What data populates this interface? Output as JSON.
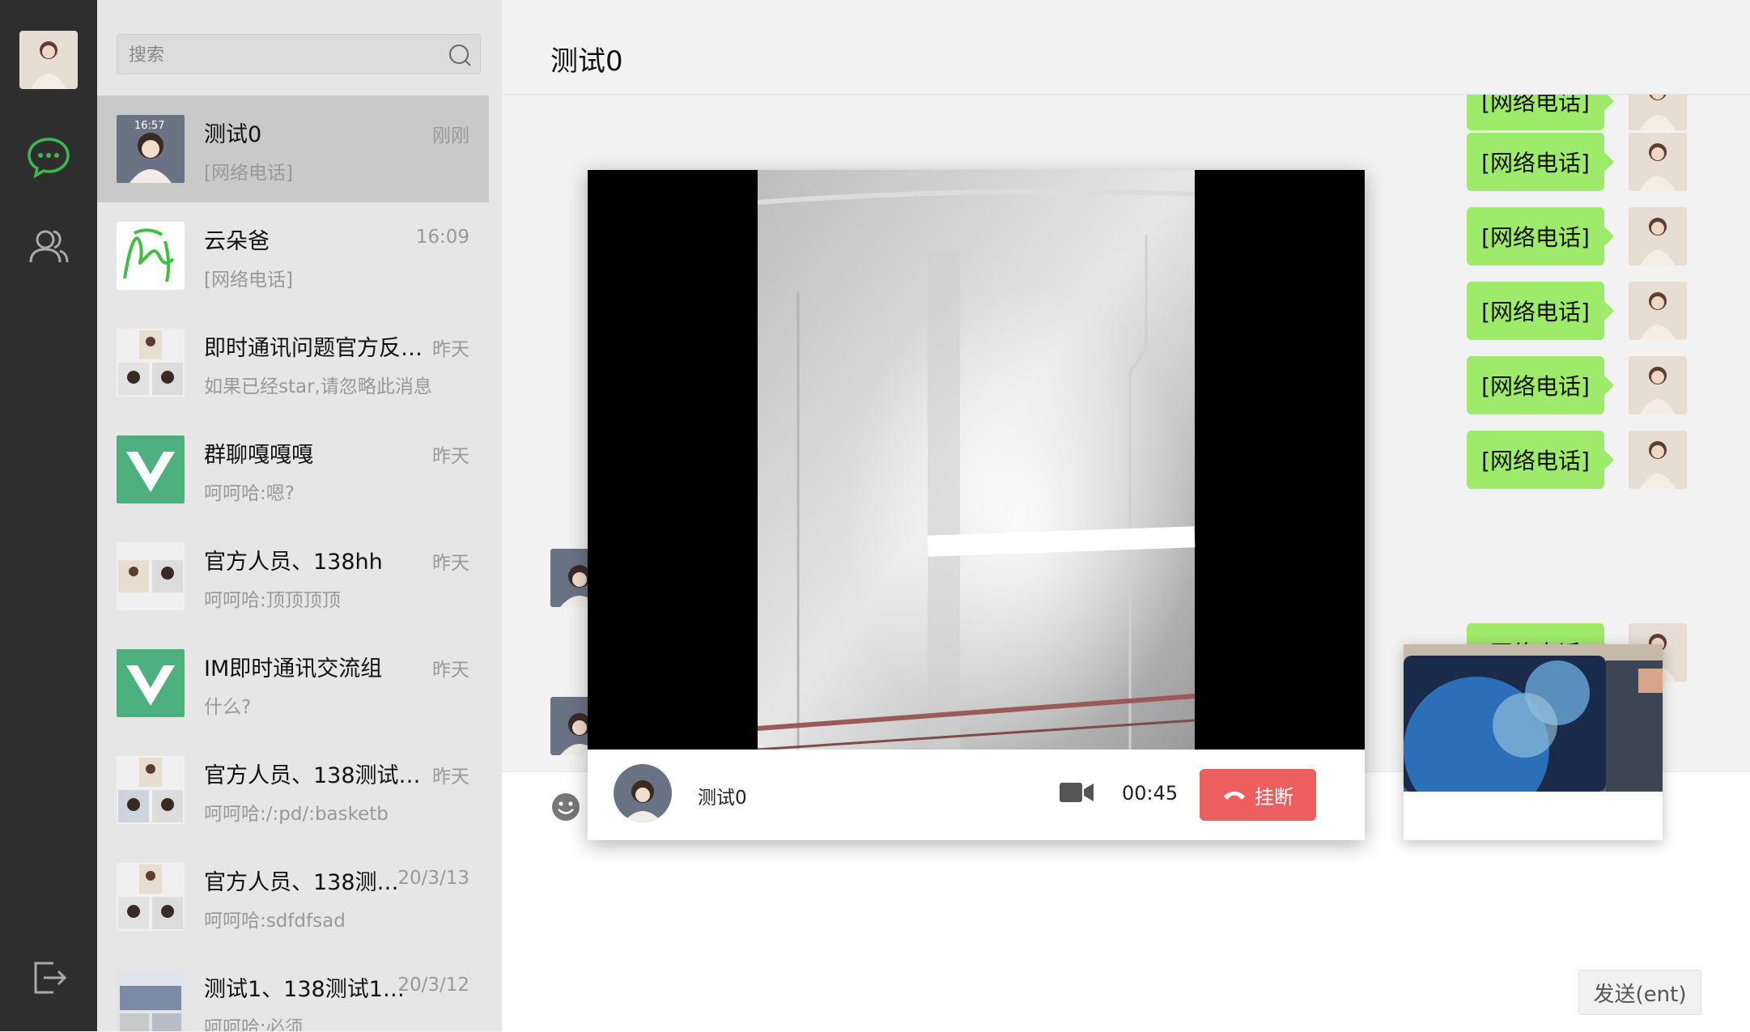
{
  "sidebar": {
    "icons": [
      "avatar",
      "chat-icon",
      "contacts-icon",
      "logout-icon"
    ]
  },
  "search": {
    "placeholder": "搜索"
  },
  "conversations": [
    {
      "name": "测试0",
      "time": "刚刚",
      "preview": "[网络电话]"
    },
    {
      "name": "云朵爸",
      "time": "16:09",
      "preview": "[网络电话]"
    },
    {
      "name": "即时通讯问题官方反…",
      "time": "昨天",
      "preview": "如果已经star,请忽略此消息"
    },
    {
      "name": "群聊嘎嘎嘎",
      "time": "昨天",
      "preview": "呵呵哈:嗯?"
    },
    {
      "name": "官方人员、138hh",
      "time": "昨天",
      "preview": "呵呵哈:顶顶顶顶"
    },
    {
      "name": "IM即时通讯交流组",
      "time": "昨天",
      "preview": "什么?"
    },
    {
      "name": "官方人员、138测试…",
      "time": "昨天",
      "preview": "呵呵哈:/:pd/:basketb"
    },
    {
      "name": "官方人员、138测…",
      "time": "20/3/13",
      "preview": "呵呵哈:sdfdfsad"
    },
    {
      "name": "测试1、138测试1…",
      "time": "20/3/12",
      "preview": "呵呵哈:必须"
    }
  ],
  "chat": {
    "title": "测试0",
    "bubbles": [
      "[网络电话]",
      "[网络电话]",
      "[网络电话]",
      "[网络电话]",
      "[网络电话]",
      "[网络电话]",
      "[网络电话]"
    ]
  },
  "composer": {
    "send_label": "发送(ent)"
  },
  "call": {
    "peer_name": "测试0",
    "duration": "00:45",
    "hangup_label": "挂断",
    "avatar_time": "16:57"
  },
  "colors": {
    "accent_green": "#3fb750",
    "bubble": "#9eea6a",
    "hangup": "#ed5e5e",
    "vue_green": "#4fb07f"
  }
}
